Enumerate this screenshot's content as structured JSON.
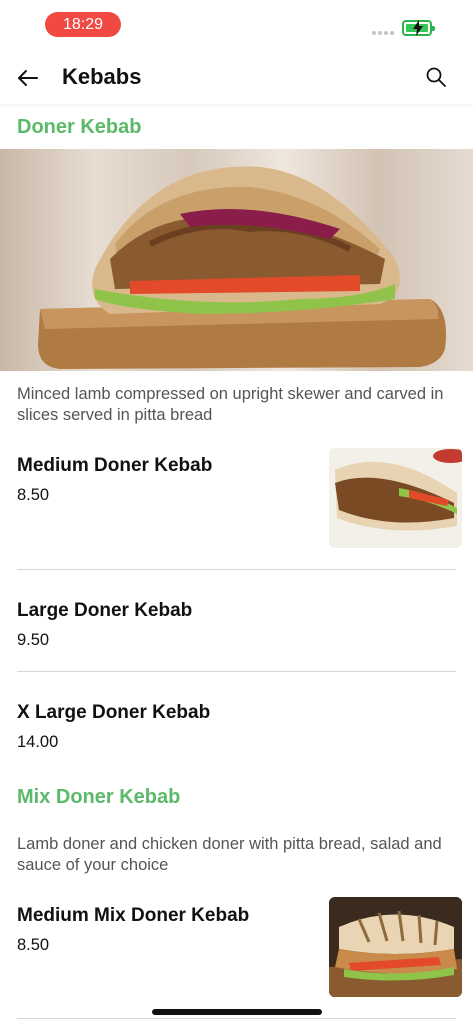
{
  "status_bar": {
    "time": "18:29"
  },
  "header": {
    "title": "Kebabs"
  },
  "sections": [
    {
      "title": "Doner Kebab",
      "description": "Minced lamb compressed on upright skewer and carved in slices served in pitta bread",
      "items": [
        {
          "name": "Medium Doner Kebab",
          "price": "8.50"
        },
        {
          "name": "Large Doner Kebab",
          "price": "9.50"
        },
        {
          "name": "X Large Doner Kebab",
          "price": "14.00"
        }
      ]
    },
    {
      "title": "Mix Doner Kebab",
      "description": "Lamb doner and chicken doner with pitta bread, salad and sauce of your choice",
      "items": [
        {
          "name": "Medium Mix Doner Kebab",
          "price": "8.50"
        }
      ]
    }
  ],
  "colors": {
    "accent": "#5cb96a",
    "time_pill": "#f04a43",
    "battery": "#34c759"
  },
  "icons": [
    "back-arrow-icon",
    "search-icon",
    "battery-charging-icon"
  ]
}
